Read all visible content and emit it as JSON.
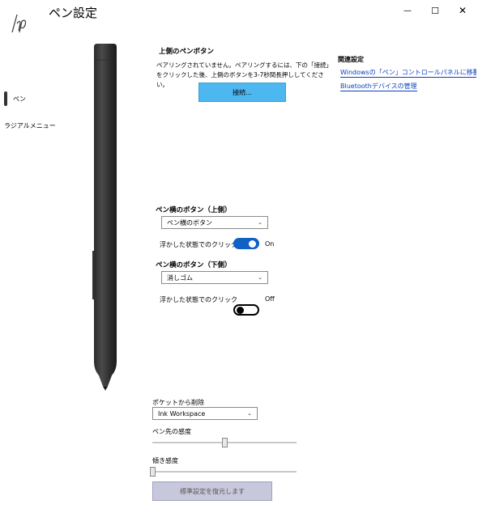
{
  "app": {
    "title": "ペン設定",
    "logo_icon": "hp-logo"
  },
  "window": {
    "minimize": "—",
    "maximize": "☐",
    "close": "✕"
  },
  "nav": {
    "items": [
      {
        "label": "ペン",
        "selected": true
      },
      {
        "label": "ラジアルメニュー",
        "selected": false
      }
    ]
  },
  "upper_button": {
    "heading": "上側のペンボタン",
    "pairing_text": "ペアリングされていません。ペアリングするには、下の「接続」をクリックした後、上側のボタンを3-7秒間長押ししてください。",
    "connect_label": "接続..."
  },
  "related": {
    "title": "関連設定",
    "link1": "Windowsの「ペン」コントロールパネルに移動しま",
    "link2": "Bluetoothデバイスの管理"
  },
  "side_upper": {
    "label": "ペン横のボタン（上側）",
    "dropdown_value": "ペン横のボタン",
    "hover_label": "浮かした状態でのクリック",
    "toggle_on": true,
    "toggle_state": "On"
  },
  "side_lower": {
    "label": "ペン横のボタン（下側）",
    "dropdown_value": "消しゴム",
    "hover_label": "浮かした状態でのクリック",
    "toggle_on": false,
    "toggle_state": "Off"
  },
  "bottom": {
    "pocket_label": "ポケットから削除",
    "pocket_value": "Ink Workspace",
    "tip_label": "ペン先の感度",
    "tip_level": 0.5,
    "tilt_label": "傾き感度",
    "tilt_level": 0.0,
    "restore_label": "標準設定を復元します"
  },
  "colors": {
    "accent": "#0f62c4",
    "connect_button": "#4db7f0",
    "link": "#0a3fbf",
    "restore_button": "#c8c8dc"
  }
}
